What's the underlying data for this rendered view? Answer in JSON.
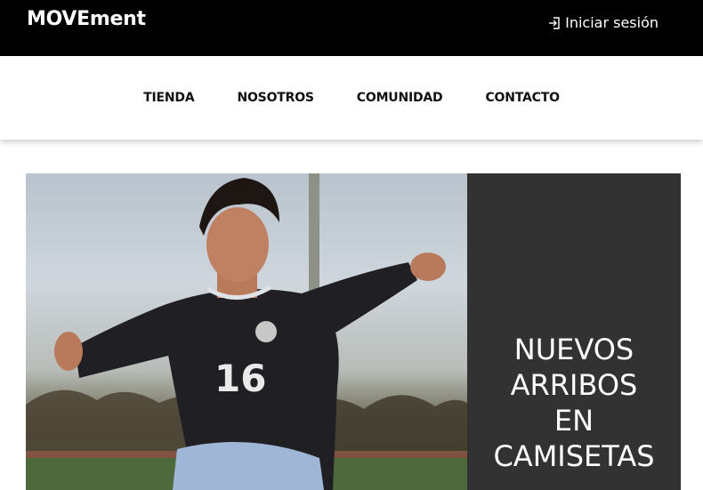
{
  "header": {
    "brand": "MOVEment",
    "login_label": "Iniciar sesión",
    "login_icon": "sign-in-icon"
  },
  "nav": {
    "items": [
      {
        "label": "TIENDA"
      },
      {
        "label": "NOSOTROS"
      },
      {
        "label": "COMUNIDAD"
      },
      {
        "label": "CONTACTO"
      }
    ]
  },
  "hero": {
    "image": "soccer-player-photo",
    "title_lines": [
      "NUEVOS",
      "ARRIBOS",
      "EN",
      "CAMISETAS"
    ],
    "jersey_number": "16"
  },
  "colors": {
    "topbar": "#000000",
    "panel": "#323232",
    "text_light": "#ffffff"
  }
}
